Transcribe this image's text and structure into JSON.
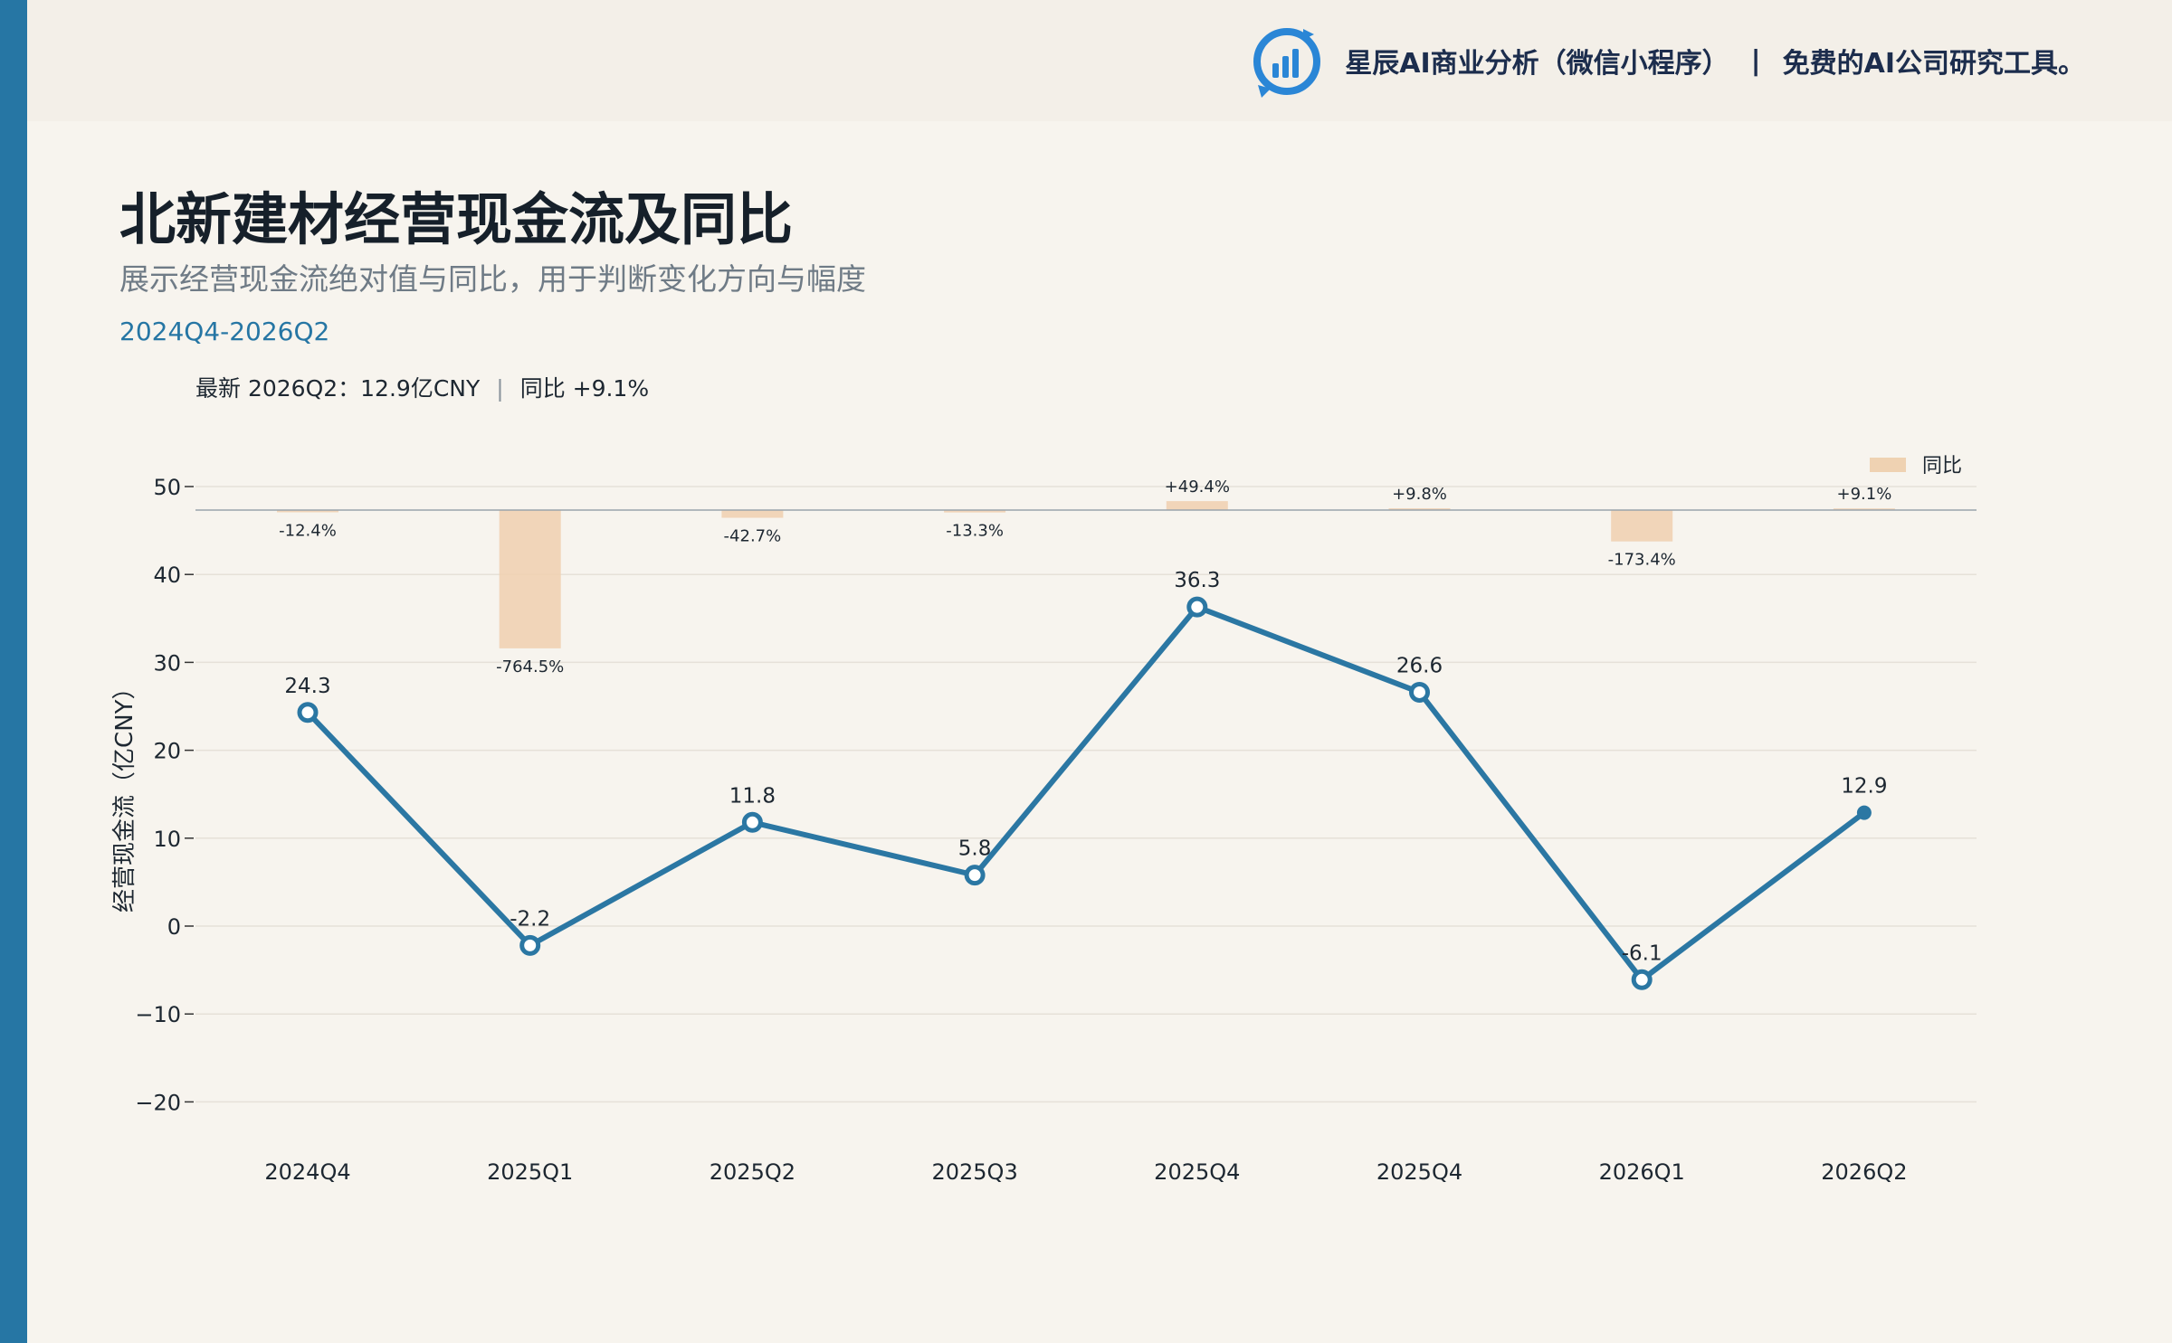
{
  "header": {
    "brand_name": "星辰AI商业分析（微信小程序）",
    "brand_separator": "|",
    "brand_tagline": "免费的AI公司研究工具。",
    "logo_icon": "bar-chart-refresh-icon"
  },
  "colors": {
    "accent": "#2676a4",
    "bar": "#efd2b2",
    "line": "#2b77a3",
    "background": "#f7f4ee"
  },
  "title": "北新建材经营现金流及同比",
  "subtitle": "展示经营现金流绝对值与同比，用于判断变化方向与幅度",
  "range": "2024Q4-2026Q2",
  "summary": {
    "latest": "最新 2026Q2：12.9亿CNY",
    "separator": "|",
    "yoy": "同比 +9.1%"
  },
  "chart_data": {
    "type": "line",
    "categories": [
      "2024Q4",
      "2025Q1",
      "2025Q2",
      "2025Q3",
      "2025Q4",
      "2025Q4",
      "2026Q1",
      "2026Q2"
    ],
    "series": [
      {
        "kind": "line",
        "values": [
          24.3,
          -2.2,
          11.8,
          5.8,
          36.3,
          26.6,
          -6.1,
          12.9
        ],
        "labels": [
          "24.3",
          "-2.2",
          "11.8",
          "5.8",
          "36.3",
          "26.6",
          "-6.1",
          "12.9"
        ]
      },
      {
        "name": "同比",
        "kind": "bar",
        "values": [
          -12.4,
          -764.5,
          -42.7,
          -13.3,
          49.4,
          9.8,
          -173.4,
          9.1
        ],
        "labels": [
          "-12.4%",
          "-764.5%",
          "-42.7%",
          "-13.3%",
          "+49.4%",
          "+9.8%",
          "-173.4%",
          "+9.1%"
        ]
      }
    ],
    "ylabel": "经营现金流（亿CNY）",
    "ylim": [
      -25,
      55
    ],
    "yticks": [
      50,
      40,
      30,
      20,
      10,
      0,
      -10,
      -20
    ],
    "ytick_labels": [
      "50",
      "40",
      "30",
      "20",
      "10",
      "0",
      "−10",
      "−20"
    ],
    "grid": true,
    "legend": "top-right"
  }
}
